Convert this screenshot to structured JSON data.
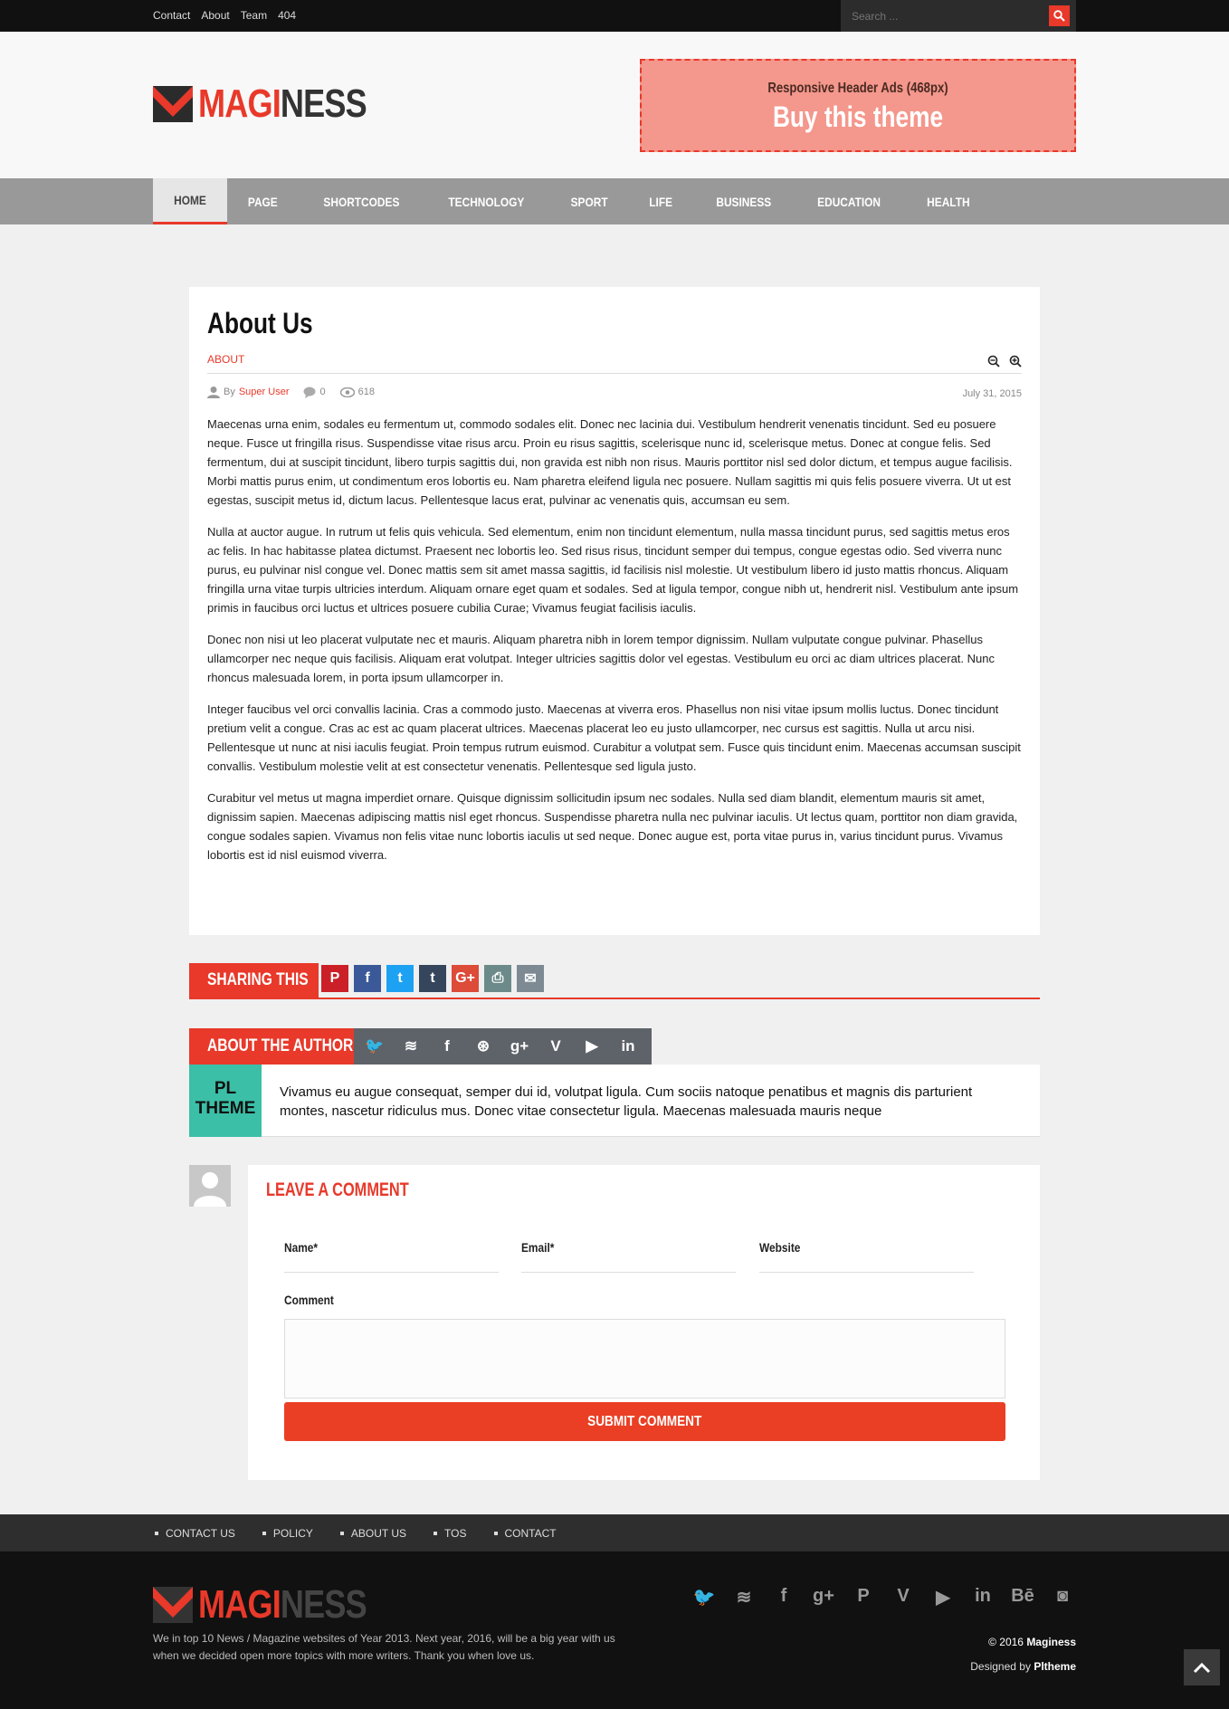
{
  "topbar": {
    "links": [
      "Contact",
      "About",
      "Team",
      "404"
    ],
    "search_placeholder": "Search ..."
  },
  "header": {
    "logo_part1": "MAGI",
    "logo_part2": "NESS",
    "ad_line1": "Responsive Header Ads (468px)",
    "ad_line2": "Buy this theme"
  },
  "nav": {
    "items": [
      "HOME",
      "PAGE",
      "SHORTCODES",
      "TECHNOLOGY",
      "SPORT",
      "LIFE",
      "BUSINESS",
      "EDUCATION",
      "HEALTH"
    ]
  },
  "article": {
    "title": "About Us",
    "category": "ABOUT",
    "by": "By",
    "author": "Super User",
    "comments": "0",
    "views": "618",
    "date": "July 31, 2015",
    "paragraphs": [
      "Maecenas urna enim, sodales eu fermentum ut, commodo sodales elit. Donec nec lacinia dui. Vestibulum hendrerit venenatis tincidunt. Sed eu posuere neque. Fusce ut fringilla risus. Suspendisse vitae risus arcu. Proin eu risus sagittis, scelerisque nunc id, scelerisque metus. Donec at congue felis. Sed fermentum, dui at suscipit tincidunt, libero turpis sagittis dui, non gravida est nibh non risus. Mauris porttitor nisl sed dolor dictum, et tempus augue facilisis. Morbi mattis purus enim, ut condimentum eros lobortis eu. Nam pharetra eleifend ligula nec posuere. Nullam sagittis mi quis felis posuere viverra. Ut ut est egestas, suscipit metus id, dictum lacus. Pellentesque lacus erat, pulvinar ac venenatis quis, accumsan eu sem.",
      "Nulla at auctor augue. In rutrum ut felis quis vehicula. Sed elementum, enim non tincidunt elementum, nulla massa tincidunt purus, sed sagittis metus eros ac felis. In hac habitasse platea dictumst. Praesent nec lobortis leo. Sed risus risus, tincidunt semper dui tempus, congue egestas odio. Sed viverra nunc purus, eu pulvinar nisl congue vel. Donec mattis sem sit amet massa sagittis, id facilisis nisl molestie. Ut vestibulum libero id justo mattis rhoncus. Aliquam fringilla urna vitae turpis ultricies interdum. Aliquam ornare eget quam et sodales. Sed at ligula tempor, congue nibh ut, hendrerit nisl. Vestibulum ante ipsum primis in faucibus orci luctus et ultrices posuere cubilia Curae; Vivamus feugiat facilisis iaculis.",
      "Donec non nisi ut leo placerat vulputate nec et mauris. Aliquam pharetra nibh in lorem tempor dignissim. Nullam vulputate congue pulvinar. Phasellus ullamcorper nec neque quis facilisis. Aliquam erat volutpat. Integer ultricies sagittis dolor vel egestas. Vestibulum eu orci ac diam ultrices placerat. Nunc rhoncus malesuada lorem, in porta ipsum ullamcorper in.",
      "Integer faucibus vel orci convallis lacinia. Cras a commodo justo. Maecenas at viverra eros. Phasellus non nisi vitae ipsum mollis luctus. Donec tincidunt pretium velit a congue. Cras ac est ac quam placerat ultrices. Maecenas placerat leo eu justo ullamcorper, nec cursus est sagittis. Nulla ut arcu nisi. Pellentesque ut nunc at nisi iaculis feugiat. Proin tempus rutrum euismod. Curabitur a volutpat sem. Fusce quis tincidunt enim. Maecenas accumsan suscipit convallis. Vestibulum molestie velit at est consectetur venenatis. Pellentesque sed ligula justo.",
      "Curabitur vel metus ut magna imperdiet ornare. Quisque dignissim sollicitudin ipsum nec sodales. Nulla sed diam blandit, elementum mauris sit amet, dignissim sapien. Maecenas adipiscing mattis nisl eget rhoncus. Suspendisse pharetra nulla nec pulvinar iaculis. Ut lectus quam, porttitor non diam gravida, congue sodales sapien. Vivamus non felis vitae nunc lobortis iaculis ut sed neque. Donec augue est, porta vitae purus in, varius tincidunt purus. Vivamus lobortis est id nisl euismod viverra."
    ]
  },
  "sharing": {
    "label": "SHARING THIS",
    "buttons": [
      {
        "icon": "pinterest-icon",
        "glyph": "P",
        "color": "#cb2027"
      },
      {
        "icon": "facebook-icon",
        "glyph": "f",
        "color": "#3b5998"
      },
      {
        "icon": "twitter-icon",
        "glyph": "t",
        "color": "#1da1f2"
      },
      {
        "icon": "tumblr-icon",
        "glyph": "t",
        "color": "#35465c"
      },
      {
        "icon": "google-plus-icon",
        "glyph": "G+",
        "color": "#dd4b39"
      },
      {
        "icon": "print-icon",
        "glyph": "⎙",
        "color": "#6d8a8a"
      },
      {
        "icon": "email-icon",
        "glyph": "✉",
        "color": "#7d8a93"
      }
    ]
  },
  "author": {
    "label": "ABOUT THE AUTHOR",
    "avatar_line1": "PL",
    "avatar_line2": "THEME",
    "bio": "Vivamus eu augue consequat, semper dui id, volutpat ligula. Cum sociis natoque penatibus et magnis dis parturient montes, nascetur ridiculus mus. Donec vitae consectetur ligula. Maecenas malesuada mauris neque",
    "social": [
      {
        "icon": "twitter-icon",
        "glyph": "🐦"
      },
      {
        "icon": "rss-icon",
        "glyph": "≋"
      },
      {
        "icon": "facebook-icon",
        "glyph": "f"
      },
      {
        "icon": "dribbble-icon",
        "glyph": "⊛"
      },
      {
        "icon": "google-plus-icon",
        "glyph": "g+"
      },
      {
        "icon": "vimeo-icon",
        "glyph": "V"
      },
      {
        "icon": "youtube-icon",
        "glyph": "▶"
      },
      {
        "icon": "linkedin-icon",
        "glyph": "in"
      }
    ]
  },
  "comment": {
    "title": "LEAVE A COMMENT",
    "name_label": "Name*",
    "email_label": "Email*",
    "website_label": "Website",
    "comment_label": "Comment",
    "submit_label": "SUBMIT COMMENT"
  },
  "footer": {
    "links": [
      "CONTACT US",
      "POLICY",
      "ABOUT US",
      "TOS",
      "CONTACT"
    ],
    "description": "We in top 10 News / Magazine websites of Year 2013. Next year, 2016, will be a big year with us when we decided open more topics with more writers. Thank you when love us.",
    "copyright_prefix": "© 2016",
    "copyright_name": "Maginess",
    "designed_prefix": "Designed by",
    "designed_name": "Pltheme",
    "social": [
      {
        "icon": "twitter-icon",
        "glyph": "🐦"
      },
      {
        "icon": "rss-icon",
        "glyph": "≋"
      },
      {
        "icon": "facebook-icon",
        "glyph": "f"
      },
      {
        "icon": "google-plus-icon",
        "glyph": "g+"
      },
      {
        "icon": "pinterest-icon",
        "glyph": "P"
      },
      {
        "icon": "vimeo-icon",
        "glyph": "V"
      },
      {
        "icon": "youtube-icon",
        "glyph": "▶"
      },
      {
        "icon": "linkedin-icon",
        "glyph": "in"
      },
      {
        "icon": "behance-icon",
        "glyph": "Bē"
      },
      {
        "icon": "instagram-icon",
        "glyph": "◙"
      }
    ]
  },
  "colors": {
    "accent": "#e8392a",
    "nav_bg": "#999999",
    "footer_bg": "#111111"
  }
}
